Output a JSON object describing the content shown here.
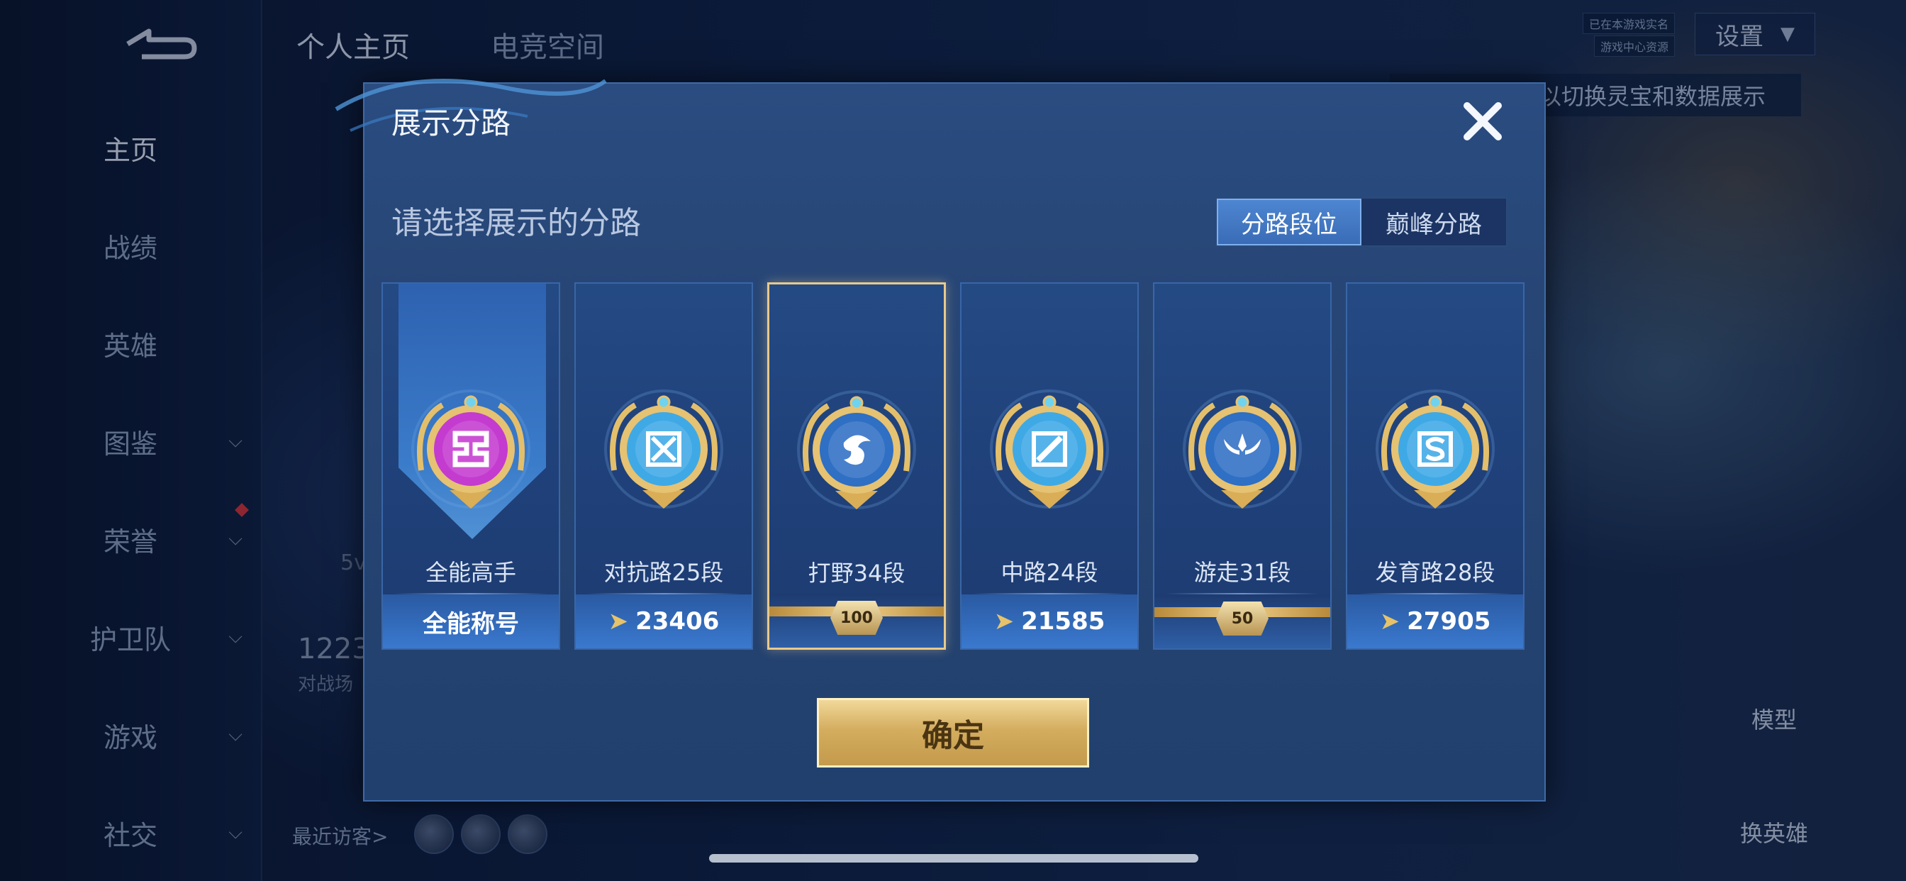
{
  "app": {
    "top_tabs": [
      "个人主页",
      "电竞空间"
    ],
    "settings_label": "设置",
    "tags": [
      "已在本游戏实名",
      "游戏中心资源"
    ],
    "hint_text": "以切换灵宝和数据展示",
    "right_buttons": [
      "模型",
      "换英雄"
    ],
    "recent_visitors_label": "最近访客>",
    "background_number": "1223",
    "background_sub": "对战场",
    "background_5v": "5v"
  },
  "sidebar": {
    "items": [
      {
        "label": "主页",
        "active": true,
        "has_chevron": false
      },
      {
        "label": "战绩",
        "active": false,
        "has_chevron": false
      },
      {
        "label": "英雄",
        "active": false,
        "has_chevron": false
      },
      {
        "label": "图鉴",
        "active": false,
        "has_chevron": true
      },
      {
        "label": "荣誉",
        "active": false,
        "has_chevron": true,
        "red_dot": true
      },
      {
        "label": "护卫队",
        "active": false,
        "has_chevron": true
      },
      {
        "label": "游戏",
        "active": false,
        "has_chevron": true
      },
      {
        "label": "社交",
        "active": false,
        "has_chevron": true
      }
    ]
  },
  "modal": {
    "title": "展示分路",
    "prompt": "请选择展示的分路",
    "segment": {
      "options": [
        "分路段位",
        "巅峰分路"
      ],
      "selected": "分路段位"
    },
    "cards": [
      {
        "label": "全能高手",
        "footer": "全能称号",
        "icon": "all-round-medal-icon",
        "medal_color": "#c43bd0",
        "selected": false,
        "footer_type": "text"
      },
      {
        "label": "对抗路25段",
        "footer": "23406",
        "icon": "clash-lane-medal-icon",
        "medal_color": "#3fa9e6",
        "selected": false,
        "footer_type": "points"
      },
      {
        "label": "打野34段",
        "footer": "100",
        "icon": "jungle-dragon-medal-icon",
        "medal_color": "#2f6fc4",
        "selected": true,
        "footer_type": "badge"
      },
      {
        "label": "中路24段",
        "footer": "21585",
        "icon": "mid-lane-medal-icon",
        "medal_color": "#3fa9e6",
        "selected": false,
        "footer_type": "points"
      },
      {
        "label": "游走31段",
        "footer": "50",
        "icon": "roam-wings-medal-icon",
        "medal_color": "#2f6fc4",
        "selected": false,
        "footer_type": "badge"
      },
      {
        "label": "发育路28段",
        "footer": "27905",
        "icon": "farm-lane-medal-icon",
        "medal_color": "#3fa9e6",
        "selected": false,
        "footer_type": "points"
      }
    ],
    "confirm_label": "确定",
    "close_icon": "close-icon"
  }
}
